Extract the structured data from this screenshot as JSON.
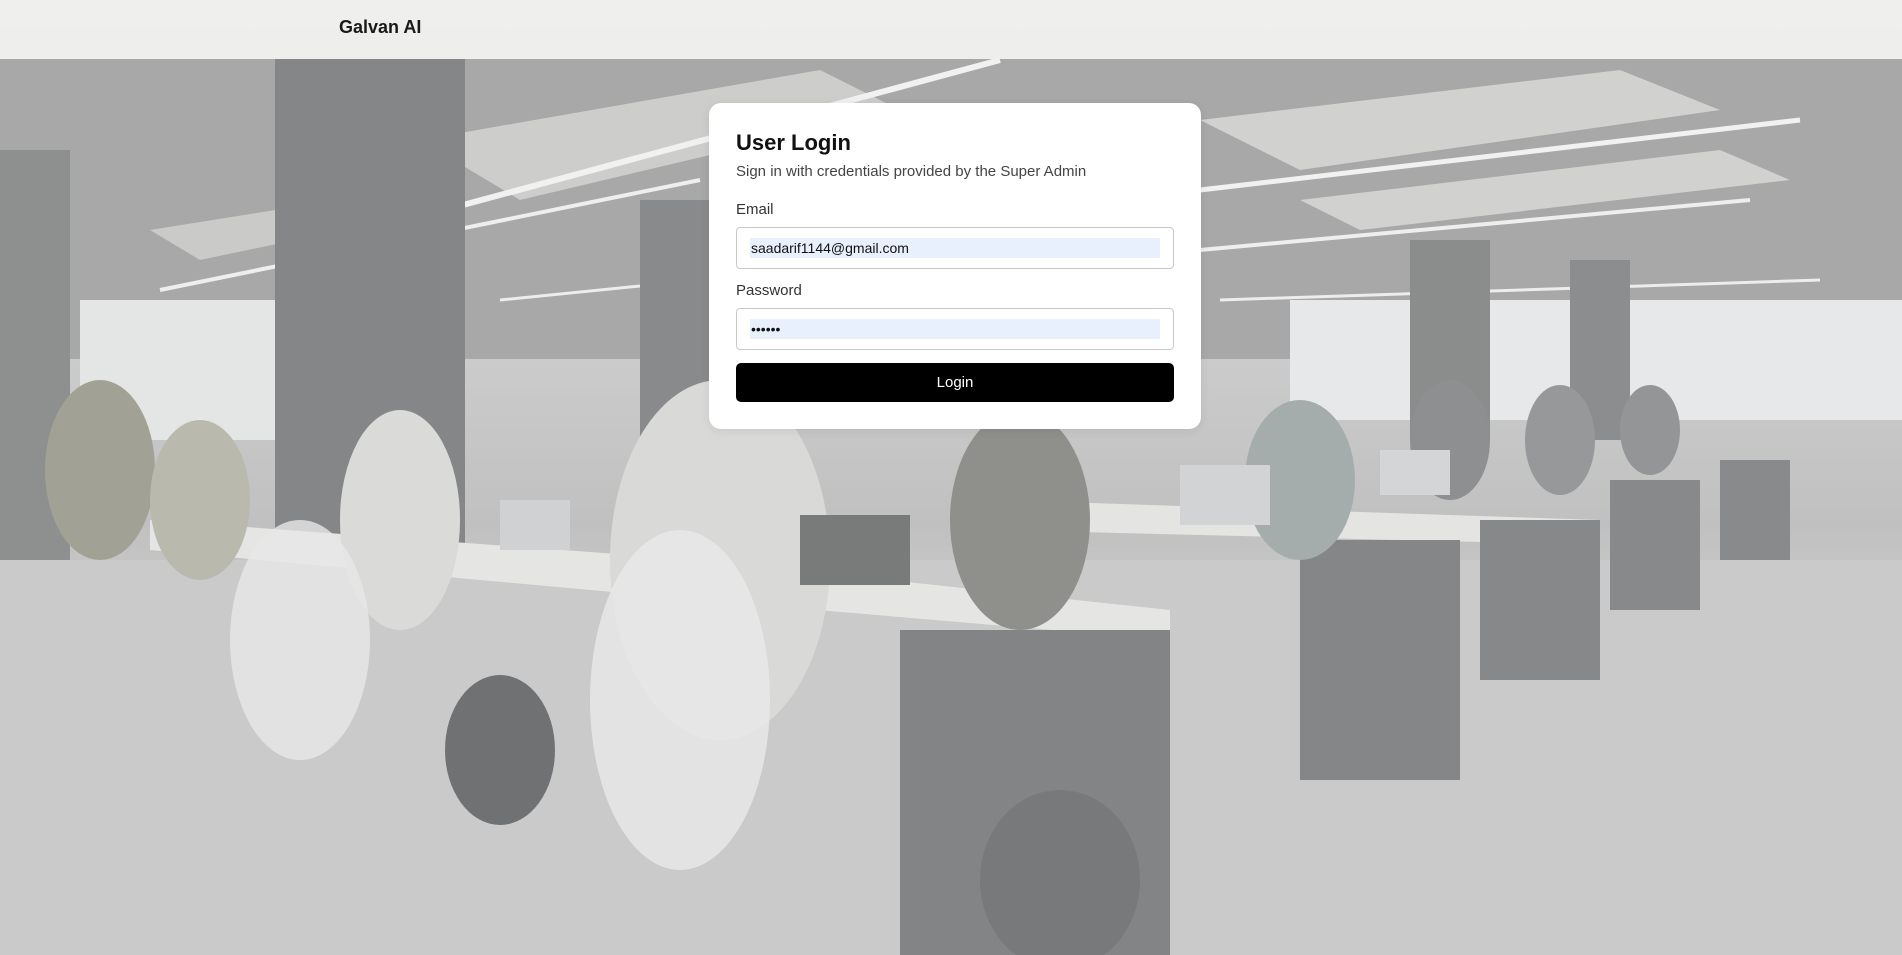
{
  "header": {
    "brand": "Galvan AI"
  },
  "login": {
    "title": "User Login",
    "subtitle": "Sign in with credentials provided by the Super Admin",
    "email_label": "Email",
    "email_value": "saadarif1144@gmail.com",
    "password_label": "Password",
    "password_value": "••••••",
    "submit_label": "Login"
  },
  "colors": {
    "button_bg": "#000000",
    "autofill_bg": "#e8f0fe"
  },
  "background": {
    "icon": "office-photo-background"
  }
}
